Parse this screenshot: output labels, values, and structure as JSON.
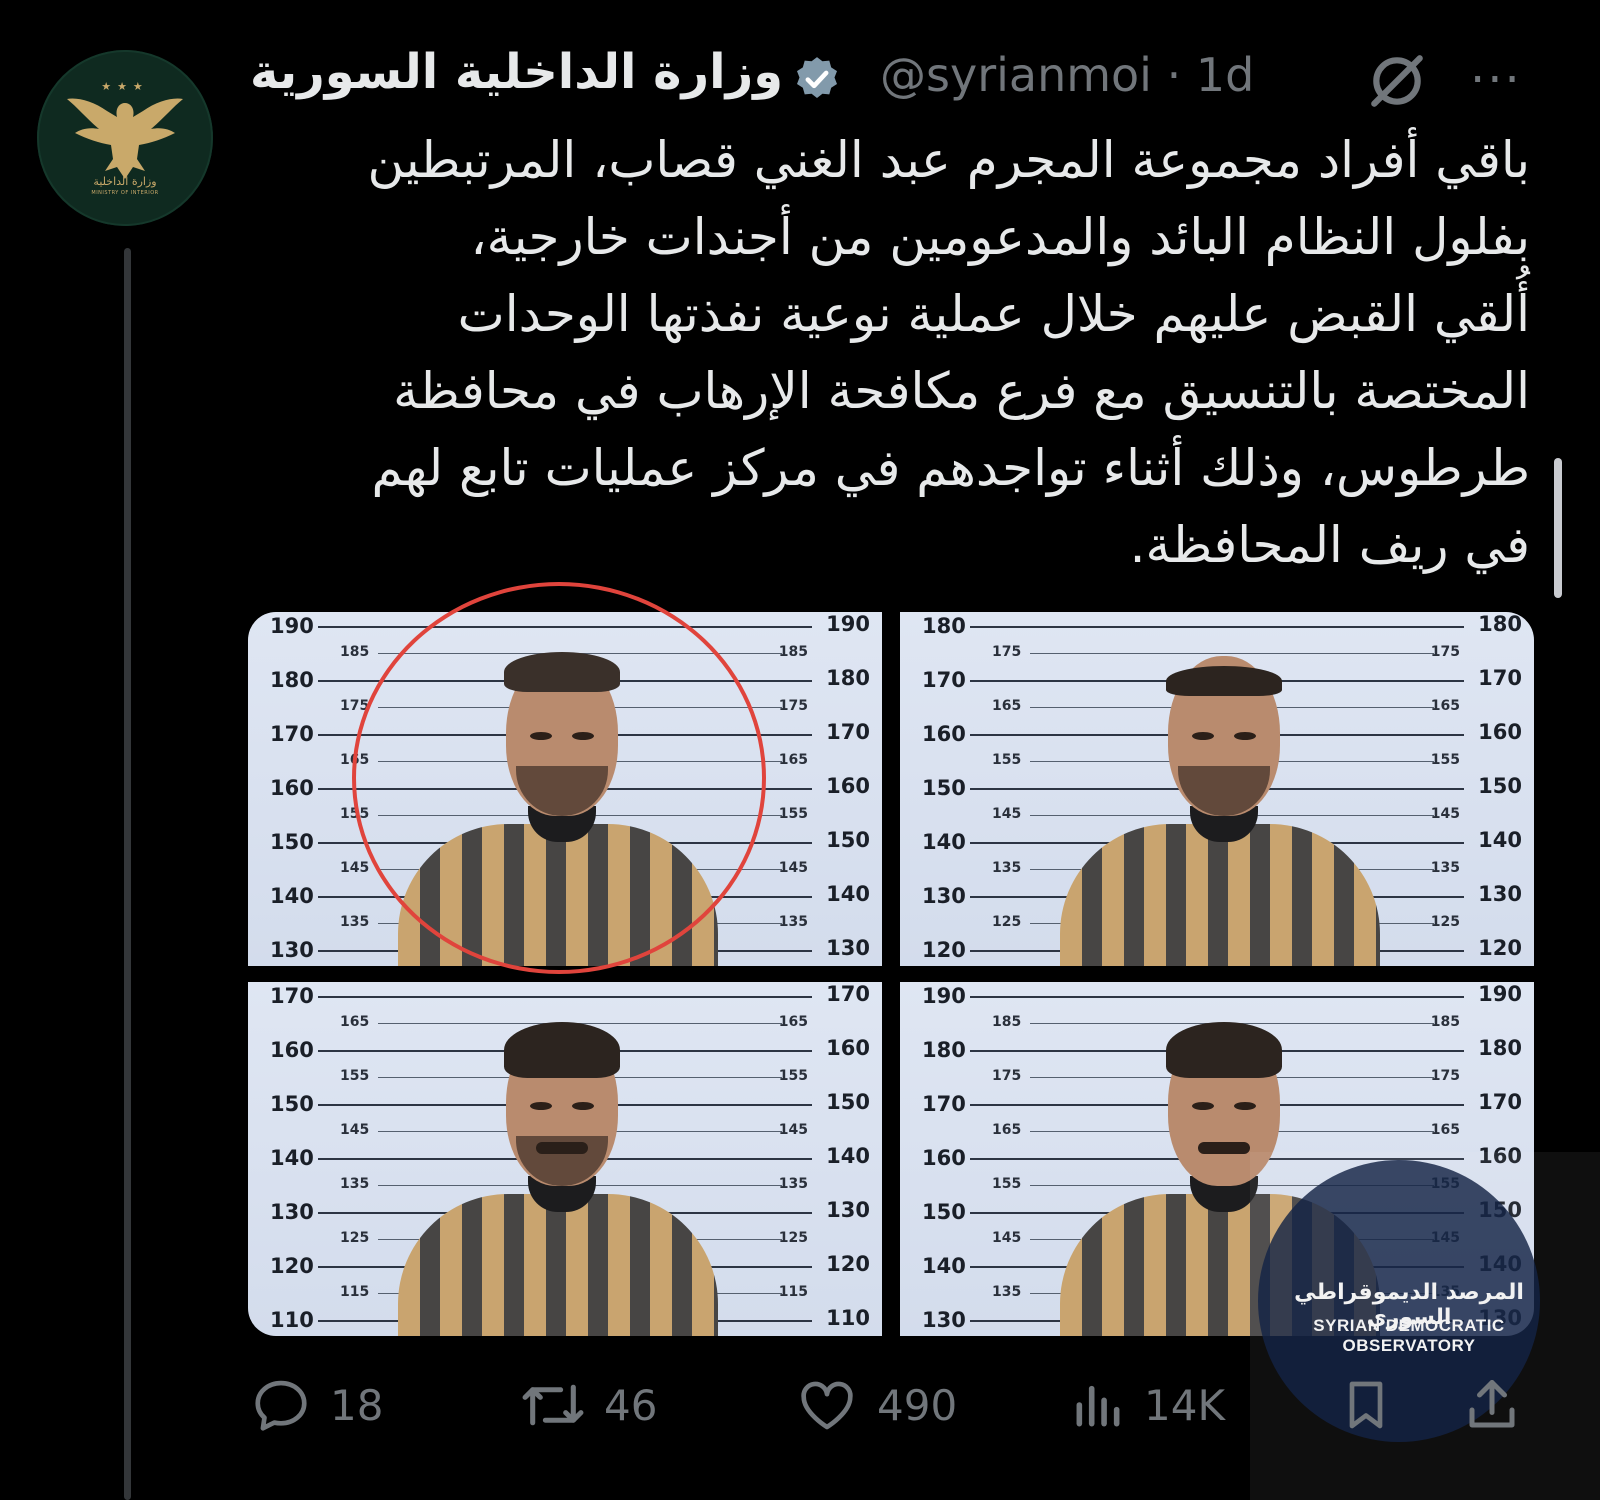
{
  "tweet": {
    "display_name": "وزارة الداخلية السورية",
    "handle": "@syrianmoi",
    "separator": "·",
    "time": "1d",
    "more_label": "···",
    "text_lines": [
      "باقي أفراد مجموعة المجرم عبد الغني قصاب، المرتبطين",
      "بفلول النظام البائد والمدعومين من أجندات خارجية،",
      "أُلقي القبض عليهم خلال عملية نوعية نفذتها الوحدات",
      "المختصة بالتنسيق مع فرع مكافحة الإرهاب في محافظة",
      "طرطوس، وذلك أثناء تواجدهم في مركز عمليات تابع لهم",
      "في ريف المحافظة."
    ]
  },
  "avatar": {
    "stars": "★★★",
    "label": "وزارة الداخلية",
    "sub_label": "MINISTRY OF INTERIOR"
  },
  "media": {
    "photos": [
      {
        "big_left": [
          "190",
          "180",
          "170",
          "160",
          "150",
          "140",
          "130"
        ],
        "small_left": [
          "185",
          "175",
          "165",
          "155",
          "145",
          "135"
        ],
        "big_right": [
          "190",
          "180",
          "170",
          "160",
          "150",
          "140",
          "130"
        ],
        "small_right": [
          "185",
          "175",
          "165",
          "155",
          "145",
          "135"
        ]
      },
      {
        "big_left": [
          "180",
          "170",
          "160",
          "150",
          "140",
          "130",
          "120"
        ],
        "small_left": [
          "175",
          "165",
          "155",
          "145",
          "135",
          "125"
        ],
        "big_right": [
          "180",
          "170",
          "160",
          "150",
          "140",
          "130",
          "120"
        ],
        "small_right": [
          "175",
          "165",
          "155",
          "145",
          "135",
          "125"
        ]
      },
      {
        "big_left": [
          "170",
          "160",
          "150",
          "140",
          "130",
          "120",
          "110"
        ],
        "small_left": [
          "165",
          "155",
          "145",
          "135",
          "125",
          "115"
        ],
        "big_right": [
          "170",
          "160",
          "150",
          "140",
          "130",
          "120",
          "110"
        ],
        "small_right": [
          "165",
          "155",
          "145",
          "135",
          "125",
          "115"
        ]
      },
      {
        "big_left": [
          "190",
          "180",
          "170",
          "160",
          "150",
          "140",
          "130"
        ],
        "small_left": [
          "185",
          "175",
          "165",
          "155",
          "145",
          "135"
        ],
        "big_right": [
          "190",
          "180",
          "170",
          "160",
          "150",
          "140",
          "130"
        ],
        "small_right": [
          "185",
          "175",
          "165",
          "155",
          "145",
          "135"
        ]
      }
    ],
    "watermark_ar": "المرصد الديموقراطي السوري",
    "watermark_en": "SYRIAN DEMOCRATIC OBSERVATORY"
  },
  "actions": {
    "replies": "18",
    "reposts": "46",
    "likes": "490",
    "views": "14K"
  },
  "colors": {
    "background": "#000000",
    "muted": "#71767b",
    "text": "#e7e9ea",
    "highlight_circle": "#e0443c",
    "verified": "#829aab"
  }
}
